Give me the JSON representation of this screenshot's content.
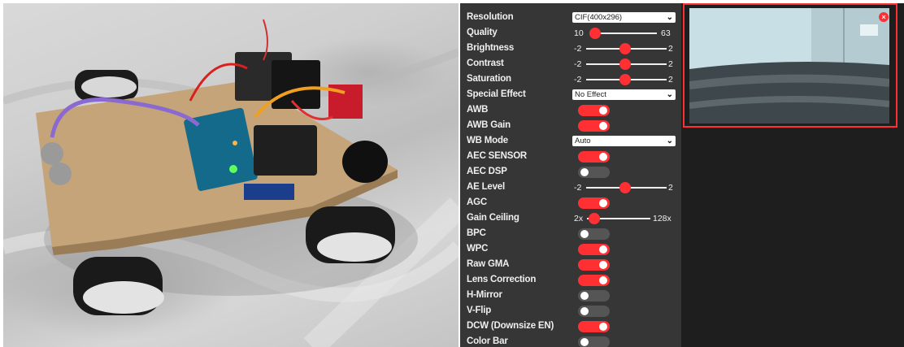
{
  "colors": {
    "accent": "#ff3034",
    "panel_bg": "#363636",
    "toggle_off": "#555555"
  },
  "controls": [
    {
      "type": "select",
      "label": "Resolution",
      "value": "CIF(400x296)"
    },
    {
      "type": "range",
      "label": "Quality",
      "min": "10",
      "max": "63",
      "position": 0.05
    },
    {
      "type": "range",
      "label": "Brightness",
      "min": "-2",
      "max": "2",
      "position": 0.5
    },
    {
      "type": "range",
      "label": "Contrast",
      "min": "-2",
      "max": "2",
      "position": 0.5
    },
    {
      "type": "range",
      "label": "Saturation",
      "min": "-2",
      "max": "2",
      "position": 0.5
    },
    {
      "type": "select",
      "label": "Special Effect",
      "value": "No Effect"
    },
    {
      "type": "toggle",
      "label": "AWB",
      "on": true
    },
    {
      "type": "toggle",
      "label": "AWB Gain",
      "on": true
    },
    {
      "type": "select",
      "label": "WB Mode",
      "value": "Auto"
    },
    {
      "type": "toggle",
      "label": "AEC SENSOR",
      "on": true
    },
    {
      "type": "toggle",
      "label": "AEC DSP",
      "on": false
    },
    {
      "type": "range",
      "label": "AE Level",
      "min": "-2",
      "max": "2",
      "position": 0.5
    },
    {
      "type": "toggle",
      "label": "AGC",
      "on": true
    },
    {
      "type": "range",
      "label": "Gain Ceiling",
      "min": "2x",
      "max": "128x",
      "position": 0.0
    },
    {
      "type": "toggle",
      "label": "BPC",
      "on": false
    },
    {
      "type": "toggle",
      "label": "WPC",
      "on": true
    },
    {
      "type": "toggle",
      "label": "Raw GMA",
      "on": true
    },
    {
      "type": "toggle",
      "label": "Lens Correction",
      "on": true
    },
    {
      "type": "toggle",
      "label": "H-Mirror",
      "on": false
    },
    {
      "type": "toggle",
      "label": "V-Flip",
      "on": false
    },
    {
      "type": "toggle",
      "label": "DCW (Downsize EN)",
      "on": true
    },
    {
      "type": "toggle",
      "label": "Color Bar",
      "on": false
    }
  ],
  "stream": {
    "close_icon": "close-icon",
    "close_glyph": "×"
  }
}
